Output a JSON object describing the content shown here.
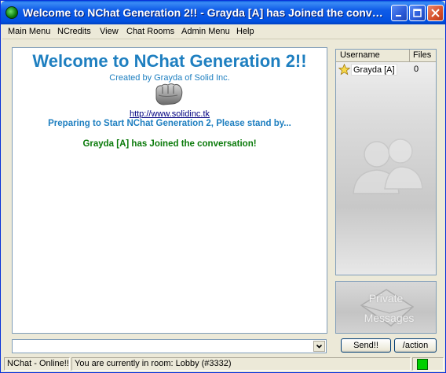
{
  "window": {
    "title": "Welcome to NChat Generation 2!! - Grayda [A] has Joined the conversati..."
  },
  "menu": [
    {
      "label": "Main Menu"
    },
    {
      "label": "NCredits"
    },
    {
      "label": "View"
    },
    {
      "label": "Chat Rooms"
    },
    {
      "label": "Admin Menu"
    },
    {
      "label": "Help"
    }
  ],
  "chat": {
    "welcome": "Welcome to NChat Generation 2!!",
    "created_by": "Created by Grayda of Solid Inc.",
    "link": "http://www.solidinc.tk",
    "preparing": "Preparing to Start NChat Generation 2, Please stand by...",
    "joined": "Grayda [A] has Joined the conversation!"
  },
  "users": {
    "col_username": "Username",
    "col_files": "Files",
    "rows": [
      {
        "name": "Grayda [A]",
        "files": "0",
        "icon": "star-icon"
      }
    ]
  },
  "pm": {
    "line1": "Private",
    "line2": "Messages"
  },
  "input": {
    "value": ""
  },
  "buttons": {
    "send": "Send!!",
    "action": "/action"
  },
  "status": {
    "online": "NChat - Online!!",
    "room": "You are currently in room: Lobby (#3332)",
    "indicator_color": "#00d000"
  },
  "colors": {
    "title_bar": "#0150e0",
    "welcome_text": "#1e7fc0",
    "joined_text": "#0a7a0a"
  }
}
